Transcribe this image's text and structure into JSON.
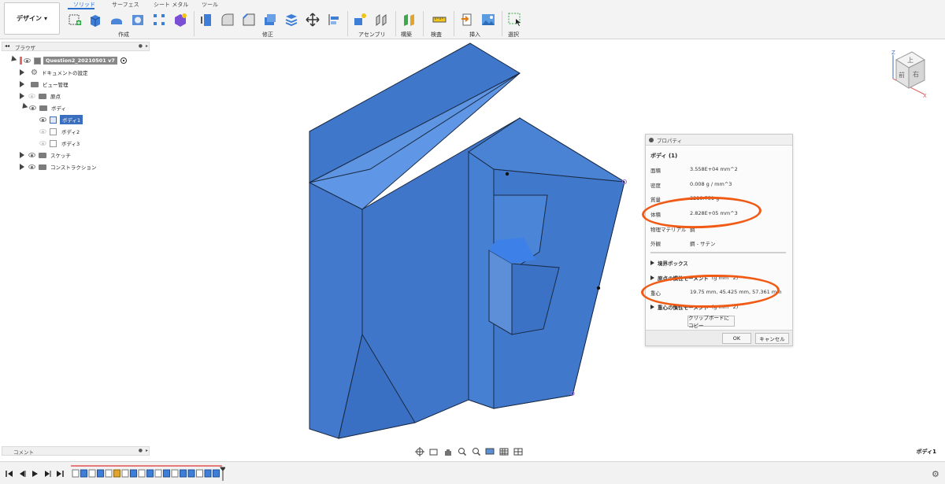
{
  "toolbar": {
    "workspace": "デザイン",
    "tabs": [
      "ソリッド",
      "サーフェス",
      "シート メタル",
      "ツール"
    ],
    "groups": [
      "作成",
      "修正",
      "アセンブリ",
      "構築",
      "検査",
      "挿入",
      "選択"
    ],
    "dropdown_glyph": "▾"
  },
  "browser": {
    "title": "ブラウザ",
    "document": "Question2_20210501 v7",
    "items": [
      {
        "label": "ドキュメントの設定"
      },
      {
        "label": "ビュー管理"
      },
      {
        "label": "原点"
      },
      {
        "label": "ボディ"
      },
      {
        "label": "ボディ1"
      },
      {
        "label": "ボディ2"
      },
      {
        "label": "ボディ3"
      },
      {
        "label": "スケッチ"
      },
      {
        "label": "コンストラクション"
      }
    ]
  },
  "comments": {
    "label": "コメント"
  },
  "viewcube": {
    "top": "上",
    "front": "前",
    "right": "右",
    "axis_x": "X",
    "axis_z": "Z"
  },
  "properties": {
    "title": "プロパティ",
    "subject": "ボディ (1)",
    "rows": [
      {
        "label": "面積",
        "value": "3.558E+04 mm^2"
      },
      {
        "label": "密度",
        "value": "0.008 g / mm^3"
      },
      {
        "label": "質量",
        "value": "2219.751 g"
      },
      {
        "label": "体積",
        "value": "2.828E+05 mm^3"
      },
      {
        "label": "物理マテリアル",
        "value": "鋼"
      },
      {
        "label": "外観",
        "value": "鋼 - サテン"
      }
    ],
    "bounding_box": "境界ボックス",
    "inertia_origin": "原点の慣性モーメント",
    "inertia_origin_unit": "(g mm^2)",
    "centroid_label": "重心",
    "centroid_value": "19.75 mm, 45.425 mm, 57.361 mm",
    "inertia_center": "重心の慣性モーメント",
    "inertia_center_unit": "(g mm^2)",
    "copy_button": "クリップボードにコピー",
    "ok": "OK",
    "cancel": "キャンセル"
  },
  "status": {
    "selection": "ボディ1"
  },
  "colors": {
    "accent": "#2b6fcf",
    "model": "#4a7fd0",
    "annotation": "#f05a14"
  }
}
